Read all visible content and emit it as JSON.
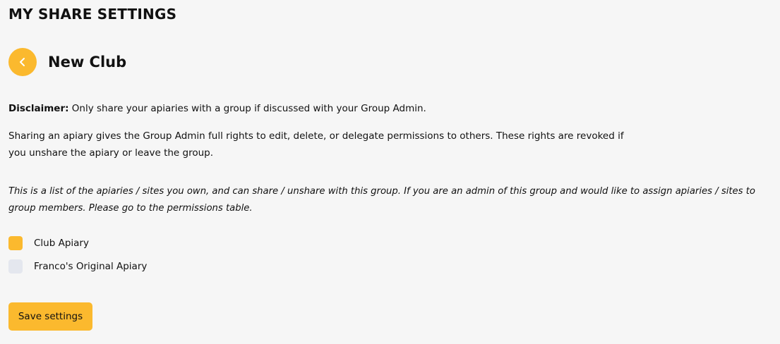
{
  "page": {
    "title": "MY SHARE SETTINGS"
  },
  "group": {
    "name": "New Club",
    "back_icon": "chevron-left-icon"
  },
  "disclaimer": {
    "label": "Disclaimer:",
    "text": " Only share your apiaries with a group if discussed with your Group Admin."
  },
  "rights_text": "Sharing an apiary gives the Group Admin full rights to edit, delete, or delegate permissions to others. These rights are revoked if you unshare the apiary or leave the group.",
  "intro_text": "This is a list of the apiaries / sites you own, and can share / unshare with this group. If you are an admin of this group and would like to assign apiaries / sites to group members. Please go to the permissions table.",
  "apiaries": [
    {
      "label": "Club Apiary",
      "checked": true
    },
    {
      "label": "Franco's Original Apiary",
      "checked": false
    }
  ],
  "actions": {
    "save_label": "Save settings"
  },
  "colors": {
    "accent": "#fbb92e",
    "background": "#f6f6f6",
    "unchecked": "#e4e7ee",
    "text": "#111111"
  }
}
